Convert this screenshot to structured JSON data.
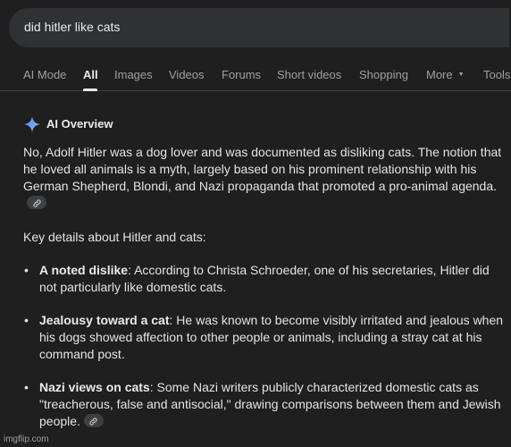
{
  "search": {
    "query": "did hitler like cats"
  },
  "tabs": [
    {
      "label": "AI Mode"
    },
    {
      "label": "All"
    },
    {
      "label": "Images"
    },
    {
      "label": "Videos"
    },
    {
      "label": "Forums"
    },
    {
      "label": "Short videos"
    },
    {
      "label": "Shopping"
    },
    {
      "label": "More"
    },
    {
      "label": "Tools"
    }
  ],
  "ai_overview": {
    "title": "AI Overview",
    "para1": "No, Adolf Hitler was a dog lover and was documented as disliking cats. The notion that he loved all animals is a myth, largely based on his prominent relationship with his German Shepherd, Blondi, and Nazi propaganda that promoted a pro-animal agenda.",
    "para2": "Key details about Hitler and cats:",
    "bullets": [
      {
        "bold": "A noted dislike",
        "text": ": According to Christa Schroeder, one of his secretaries, Hitler did not particularly like domestic cats."
      },
      {
        "bold": "Jealousy toward a cat",
        "text": ": He was known to become visibly irritated and jealous when his dogs showed affection to other people or animals, including a stray cat at his command post."
      },
      {
        "bold": "Nazi views on cats",
        "text": ": Some Nazi writers publicly characterized domestic cats as \"treacherous, false and antisocial,\" drawing comparisons between them and Jewish people."
      }
    ]
  },
  "watermark": "imgflip.com",
  "colors": {
    "background": "#1f1f1f",
    "search_bar": "#303134",
    "text": "#e3e3e3",
    "tab_inactive": "#9aa0a6"
  }
}
